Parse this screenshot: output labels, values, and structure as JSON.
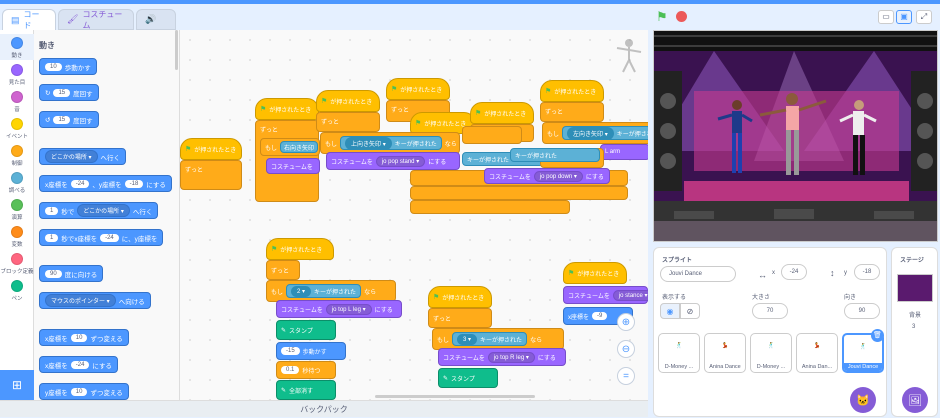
{
  "tabs": {
    "code": "コード",
    "costume": "コスチューム",
    "sound": ""
  },
  "categories": [
    {
      "label": "動き",
      "color": "#4c97ff"
    },
    {
      "label": "見た目",
      "color": "#9966ff"
    },
    {
      "label": "音",
      "color": "#cf63cf"
    },
    {
      "label": "イベント",
      "color": "#ffd500"
    },
    {
      "label": "制御",
      "color": "#ffab19"
    },
    {
      "label": "調べる",
      "color": "#5cb1d6"
    },
    {
      "label": "演算",
      "color": "#59c059"
    },
    {
      "label": "変数",
      "color": "#ff8c1a"
    },
    {
      "label": "ブロック定義",
      "color": "#ff6680"
    },
    {
      "label": "ペン",
      "color": "#0fbd8c"
    }
  ],
  "flyout": {
    "title": "動き",
    "b1": {
      "pre": "",
      "val": "10",
      "post": "歩動かす"
    },
    "b2": {
      "val": "15",
      "post": "度回す"
    },
    "b3": {
      "val": "15",
      "post": "度回す"
    },
    "b4": {
      "drop": "どこかの場所",
      "post": "へ行く"
    },
    "b5": {
      "pre": "x座標を",
      "x": "-24",
      "mid": "、y座標を",
      "y": "-18",
      "post": "にする"
    },
    "b6": {
      "val": "1",
      "mid": "秒で",
      "drop": "どこかの場所",
      "post": "へ行く"
    },
    "b7": {
      "val": "1",
      "mid": "秒でx座標を",
      "x": "-24",
      "mid2": "に、y座標を"
    },
    "b8": {
      "val": "90",
      "post": "度に向ける"
    },
    "b9": {
      "drop": "マウスのポインター",
      "post": "へ向ける"
    },
    "b10": {
      "pre": "x座標を",
      "val": "10",
      "post": "ずつ変える"
    },
    "b11": {
      "pre": "x座標を",
      "val": "-24",
      "post": "にする"
    },
    "b12": {
      "pre": "y座標を",
      "val": "10",
      "post": "ずつ変える"
    }
  },
  "script": {
    "hat": "が押されたとき",
    "forever": "ずっと",
    "if": "もし",
    "then": "なら",
    "key_pressed": "キーが押された",
    "costume_to": "コスチュームを",
    "set_to": "にする",
    "stamp": "スタンプ",
    "steps": "歩動かす",
    "wait": "秒待つ",
    "clear": "全部消す",
    "k_right": "右向き矢印",
    "k_up": "上向き矢印",
    "k_left": "左向き矢印",
    "k_2": "2",
    "k_3": "3",
    "c_stand": "jo pop stand",
    "c_down": "jo pop down",
    "c_lleg": "jo top L leg",
    "c_rleg": "jo top R leg",
    "c_stance": "jo stance",
    "c_arm": "L arm",
    "n_-15": "-15",
    "n_01": "0.1",
    "x_pre": "x座標を",
    "x_val": "-9"
  },
  "backpack": "バックパック",
  "sprite_panel": {
    "title": "スプライト",
    "name": "Jouvi Dance",
    "x_label": "x",
    "x": "-24",
    "y_label": "y",
    "y": "-18",
    "show_label": "表示する",
    "size_label": "大きさ",
    "size": "70",
    "dir_label": "向き",
    "dir": "90",
    "sprites": [
      "D-Money ...",
      "Anina Dance",
      "D-Money ...",
      "Anina Dan...",
      "Jouvi Dance"
    ]
  },
  "stage_panel": {
    "title": "ステージ",
    "bg_label": "背景",
    "bg_count": "3"
  },
  "colors": {
    "accent": "#4c97ff",
    "events": "#ffbf00",
    "control": "#ffab19",
    "sensing": "#5cb1d6",
    "looks": "#9966ff",
    "pen": "#0fbd8c"
  }
}
